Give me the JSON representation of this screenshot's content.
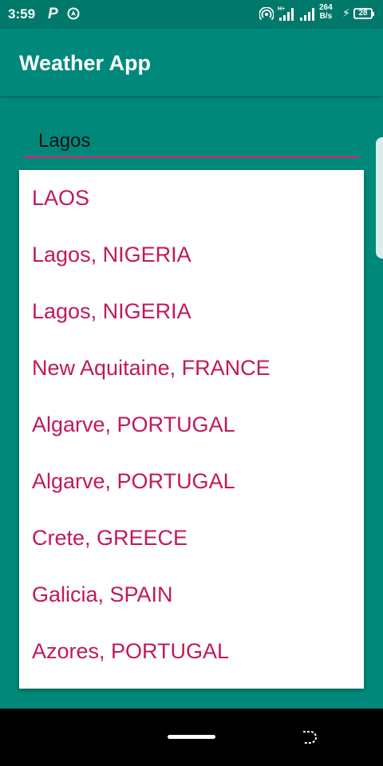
{
  "status_bar": {
    "time": "3:59",
    "p_icon": "P",
    "speed_value": "264",
    "speed_unit": "B/s",
    "battery_level": "28",
    "signal_tag": "H+",
    "icons": [
      "p-icon",
      "nav-app-icon",
      "hotspot-icon",
      "signal-icon",
      "signal-icon",
      "charging-icon",
      "battery-icon"
    ]
  },
  "app_bar": {
    "title": "Weather App"
  },
  "search": {
    "value": "Lagos"
  },
  "suggestions": [
    "LAOS",
    "Lagos, NIGERIA",
    "Lagos, NIGERIA",
    "New Aquitaine, FRANCE",
    "Algarve, PORTUGAL",
    "Algarve, PORTUGAL",
    "Crete, GREECE",
    "Galicia, SPAIN",
    "Azores, PORTUGAL"
  ],
  "nav_bar": {
    "icons": [
      "home-indicator",
      "back-gesture-icon"
    ]
  },
  "colors": {
    "primary": "#00897b",
    "primary_dark": "#00796b",
    "accent": "#e91e63",
    "suggestion_text": "#c2185b"
  }
}
